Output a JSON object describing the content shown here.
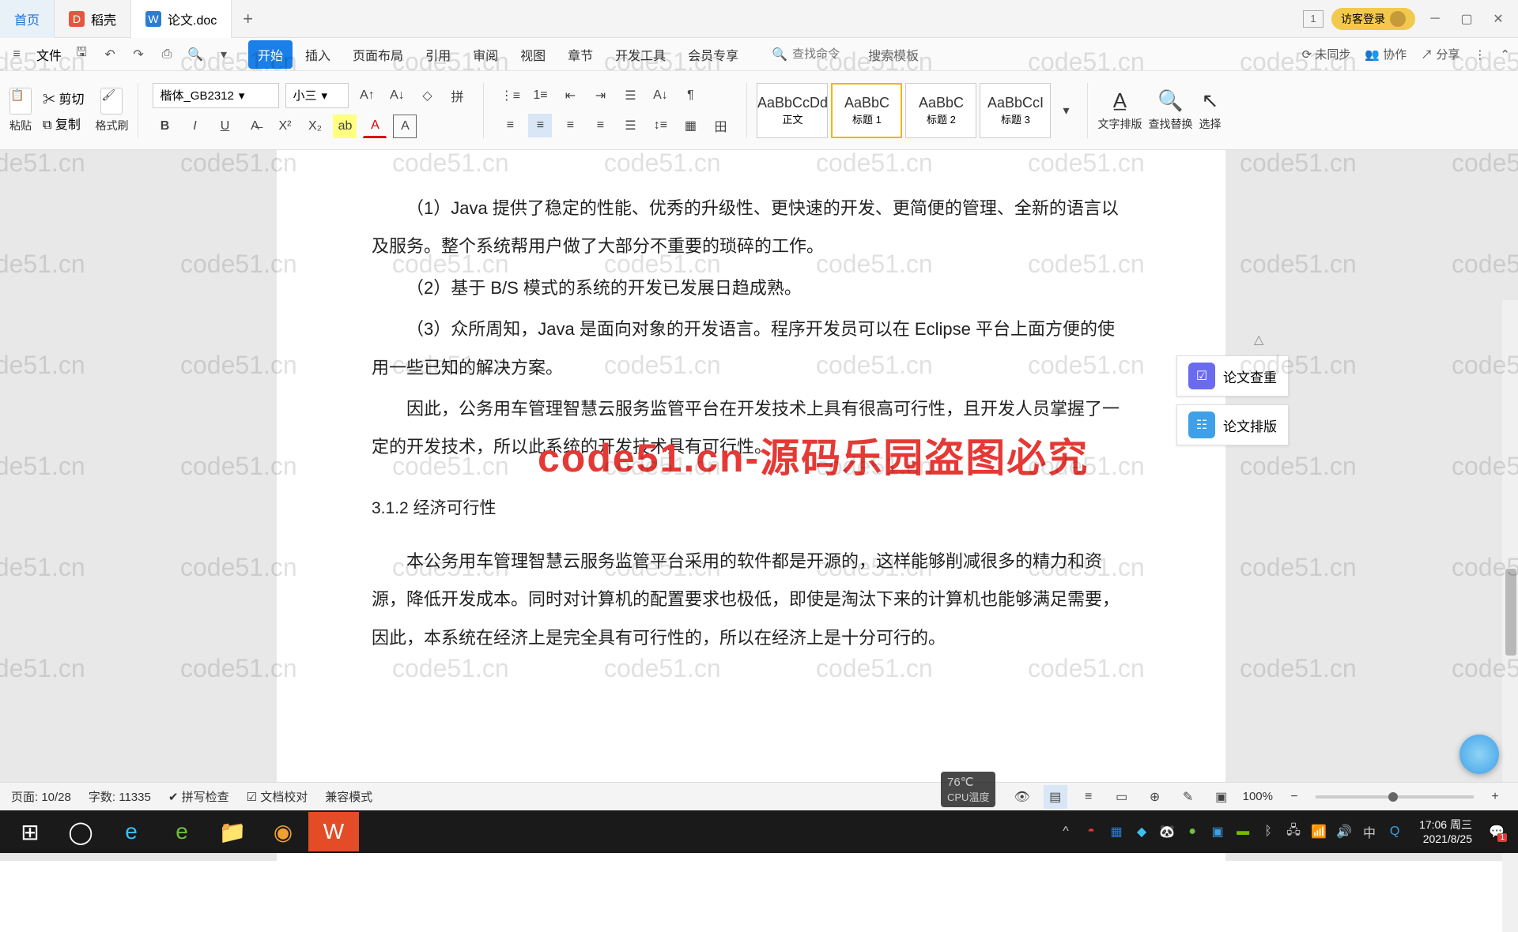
{
  "tabs": {
    "home": "首页",
    "t1": "稻壳",
    "t2": "论文.doc",
    "guest": "访客登录",
    "badge": "1"
  },
  "quick": {
    "file": "文件",
    "search_ph": "查找命令",
    "template": "搜索模板",
    "unsync": "未同步",
    "collab": "协作",
    "share": "分享"
  },
  "menu": [
    "开始",
    "插入",
    "页面布局",
    "引用",
    "审阅",
    "视图",
    "章节",
    "开发工具",
    "会员专享"
  ],
  "ribbon": {
    "paste": "粘贴",
    "cut": "剪切",
    "copy": "复制",
    "format_painter": "格式刷",
    "font": "楷体_GB2312",
    "size": "小三",
    "styles": [
      {
        "preview": "AaBbCcDd",
        "name": "正文"
      },
      {
        "preview": "AaBbC",
        "name": "标题 1"
      },
      {
        "preview": "AaBbC",
        "name": "标题 2"
      },
      {
        "preview": "AaBbCcI",
        "name": "标题 3"
      }
    ],
    "text_layout": "文字排版",
    "find_replace": "查找替换",
    "select": "选择"
  },
  "doc": {
    "p1": "（1）Java 提供了稳定的性能、优秀的升级性、更快速的开发、更简便的管理、全新的语言以及服务。整个系统帮用户做了大部分不重要的琐碎的工作。",
    "p2": "（2）基于 B/S 模式的系统的开发已发展日趋成熟。",
    "p3": "（3）众所周知，Java 是面向对象的开发语言。程序开发员可以在 Eclipse 平台上面方便的使用一些已知的解决方案。",
    "p4": "因此，公务用车管理智慧云服务监管平台在开发技术上具有很高可行性，且开发人员掌握了一定的开发技术，所以此系统的开发技术具有可行性。",
    "h": "3.1.2 经济可行性",
    "p5": "本公务用车管理智慧云服务监管平台采用的软件都是开源的，这样能够削减很多的精力和资源，降低开发成本。同时对计算机的配置要求也极低，即使是淘汰下来的计算机也能够满足需要，因此，本系统在经济上是完全具有可行性的，所以在经济上是十分可行的。"
  },
  "overlay": "code51.cn-源码乐园盗图必究",
  "watermark": "code51.cn",
  "side": {
    "check": "论文查重",
    "layout": "论文排版"
  },
  "status": {
    "page": "页面: 10/28",
    "words": "字数: 11335",
    "spell": "拼写检查",
    "proof": "文档校对",
    "compat": "兼容模式",
    "zoom": "100%"
  },
  "cpu": {
    "label": "CPU温度",
    "temp": "76℃"
  },
  "clock": {
    "time": "17:06",
    "day": "周三",
    "date": "2021/8/25"
  }
}
